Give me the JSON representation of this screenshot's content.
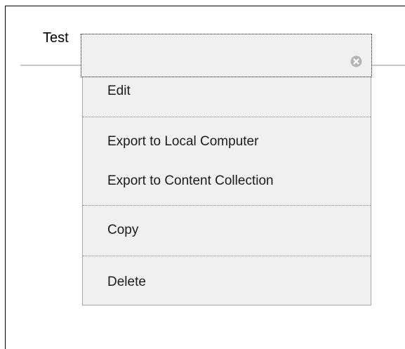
{
  "item": {
    "title": "Test"
  },
  "context_menu": {
    "close_icon": "close-circle-icon",
    "items": [
      {
        "label": "Edit"
      },
      {
        "label": "Export to Local Computer"
      },
      {
        "label": "Export to Content Collection"
      },
      {
        "label": "Copy"
      },
      {
        "label": "Delete"
      }
    ]
  },
  "colors": {
    "menu_background": "#f0f0f0",
    "menu_text": "#1c1c1c",
    "close_icon": "#b5b5b5"
  }
}
